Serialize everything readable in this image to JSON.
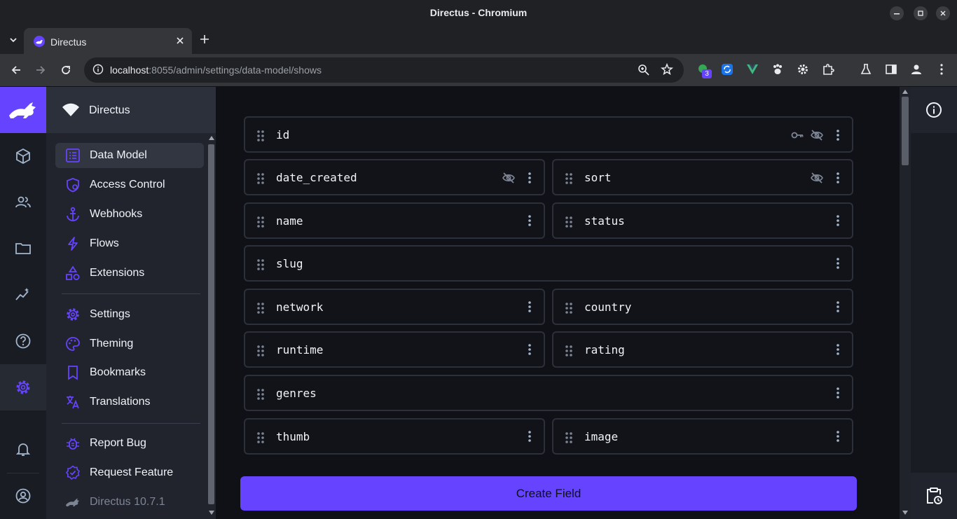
{
  "window": {
    "title": "Directus - Chromium"
  },
  "tab": {
    "title": "Directus"
  },
  "address": {
    "host": "localhost",
    "rest": ":8055/admin/settings/data-model/shows"
  },
  "extensions": {
    "badge_count": "3"
  },
  "project": {
    "name": "Directus"
  },
  "nav": {
    "items": [
      {
        "label": "Data Model",
        "icon": "data-model-icon"
      },
      {
        "label": "Access Control",
        "icon": "shield-icon"
      },
      {
        "label": "Webhooks",
        "icon": "anchor-icon"
      },
      {
        "label": "Flows",
        "icon": "bolt-icon"
      },
      {
        "label": "Extensions",
        "icon": "shapes-icon"
      },
      {
        "label": "Settings",
        "icon": "gear-icon"
      },
      {
        "label": "Theming",
        "icon": "palette-icon"
      },
      {
        "label": "Bookmarks",
        "icon": "bookmark-icon"
      },
      {
        "label": "Translations",
        "icon": "translate-icon"
      },
      {
        "label": "Report Bug",
        "icon": "bug-icon"
      },
      {
        "label": "Request Feature",
        "icon": "feature-icon"
      },
      {
        "label": "Directus 10.7.1",
        "icon": "directus-logo-icon"
      }
    ]
  },
  "fields": [
    {
      "name": "id"
    },
    {
      "name": "date_created"
    },
    {
      "name": "sort"
    },
    {
      "name": "name"
    },
    {
      "name": "status"
    },
    {
      "name": "slug"
    },
    {
      "name": "network"
    },
    {
      "name": "country"
    },
    {
      "name": "runtime"
    },
    {
      "name": "rating"
    },
    {
      "name": "genres"
    },
    {
      "name": "thumb"
    },
    {
      "name": "image"
    }
  ],
  "actions": {
    "create_field": "Create Field"
  },
  "colors": {
    "accent": "#6644ff",
    "background": "#0f1116",
    "nav": "#21242c",
    "rail": "#1a1c23"
  }
}
